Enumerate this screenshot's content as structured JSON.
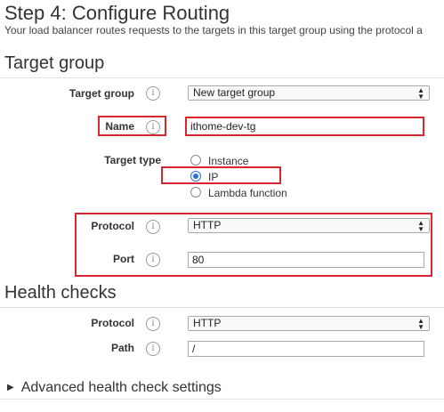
{
  "header": {
    "title": "Step 4: Configure Routing",
    "description": "Your load balancer routes requests to the targets in this target group using the protocol a"
  },
  "target_group": {
    "section_title": "Target group",
    "target_group_label": "Target group",
    "target_group_value": "New target group",
    "name_label": "Name",
    "name_value": "ithome-dev-tg",
    "target_type_label": "Target type",
    "target_type_options": [
      "Instance",
      "IP",
      "Lambda function"
    ],
    "target_type_selected": "IP",
    "protocol_label": "Protocol",
    "protocol_value": "HTTP",
    "port_label": "Port",
    "port_value": "80"
  },
  "health_checks": {
    "section_title": "Health checks",
    "protocol_label": "Protocol",
    "protocol_value": "HTTP",
    "path_label": "Path",
    "path_value": "/",
    "advanced_label": "Advanced health check settings"
  },
  "icons": {
    "info": "info-icon",
    "select_arrow": "select-arrow-icon",
    "expand": "caret-right-icon"
  },
  "colors": {
    "highlight": "#d7262e",
    "radio_selected": "#2a6fdb"
  }
}
